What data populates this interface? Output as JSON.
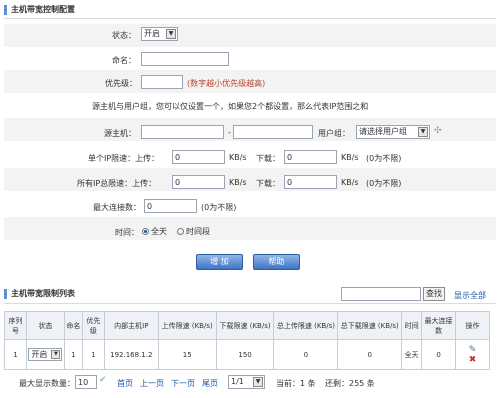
{
  "config": {
    "title": "主机带宽控制配置",
    "status_label": "状态：",
    "status_value": "开启",
    "name_label": "命名：",
    "name_value": "",
    "priority_label": "优先级：",
    "priority_value": "",
    "priority_hint": "(数字越小优先级越高)",
    "notice": "源主机与用户组，您可以仅设置一个，如果您2个都设置，那么代表IP范围之和",
    "source_label": "源主机：",
    "source_sep": "-",
    "source_start": "",
    "source_end": "",
    "group_label": "用户组：",
    "group_value": "请选择用户组",
    "per_ip_label": "单个IP限速：上传：",
    "per_ip_up": "0",
    "per_ip_unit1": "KB/s",
    "per_ip_down_label": "下载：",
    "per_ip_down": "0",
    "per_ip_unit2": "KB/s",
    "per_ip_hint": "(0为不限)",
    "all_ip_label": "所有IP总限速：上传：",
    "all_ip_up": "0",
    "all_ip_unit1": "KB/s",
    "all_ip_down_label": "下载：",
    "all_ip_down": "0",
    "all_ip_unit2": "KB/s",
    "all_ip_hint": "(0为不限)",
    "maxconn_label": "最大连接数：",
    "maxconn_value": "0",
    "maxconn_hint": "(0为不限)",
    "time_label": "时间：",
    "time_opt1": "全天",
    "time_opt2": "时间段",
    "add_button": "增 加",
    "help_button": "帮助"
  },
  "list": {
    "title": "主机带宽限制列表",
    "search_value": "",
    "search_button": "查找",
    "show_all": "显示全部",
    "headers": [
      "序列号",
      "状态",
      "命名",
      "优先级",
      "内部主机IP",
      "上传限速 (KB/s)",
      "下载限速 (KB/s)",
      "总上传限速 (KB/s)",
      "总下载限速 (KB/s)",
      "时间",
      "最大连接数",
      "操作"
    ],
    "rows": [
      {
        "index": "1",
        "status": "开启",
        "name": "1",
        "priority": "1",
        "ip": "192.168.1.2",
        "up": "15",
        "down": "150",
        "total_up": "0",
        "total_down": "0",
        "time": "全天",
        "maxconn": "0"
      }
    ]
  },
  "pager": {
    "max_label": "最大显示数量：",
    "max_value": "10",
    "first": "首页",
    "prev": "上一页",
    "next": "下一页",
    "last": "尾页",
    "page_value": "1/1",
    "current": "当前：1 条",
    "total": "还剩：255 条"
  }
}
